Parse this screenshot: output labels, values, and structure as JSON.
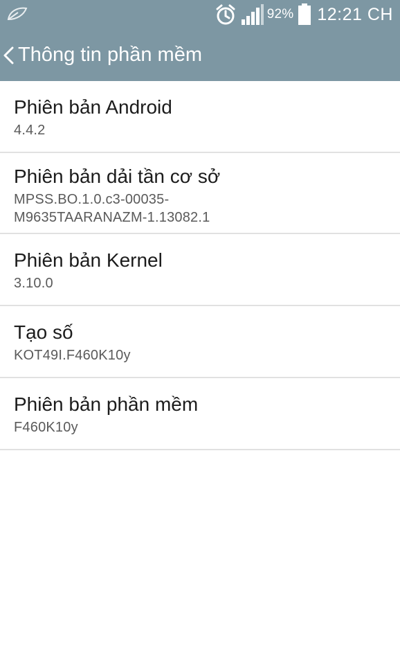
{
  "status_bar": {
    "leaf_icon": "leaf-icon",
    "alarm_icon": "alarm-clock-icon",
    "signal_icon": "signal-bars-icon",
    "battery_percent": "92%",
    "battery_icon": "battery-icon",
    "battery_level": 0.92,
    "time": "12:21 CH"
  },
  "action_bar": {
    "back_icon": "chevron-left-icon",
    "title": "Thông tin phần mềm",
    "background_color": "#7d97a3"
  },
  "items": [
    {
      "title": "Phiên bản Android",
      "value": "4.4.2"
    },
    {
      "title": "Phiên bản dải tần cơ sở",
      "value": "MPSS.BO.1.0.c3-00035-\nM9635TAARANAZM-1.13082.1"
    },
    {
      "title": "Phiên bản Kernel",
      "value": "3.10.0"
    },
    {
      "title": "Tạo số",
      "value": "KOT49I.F460K10y"
    },
    {
      "title": "Phiên bản phần mềm",
      "value": "F460K10y"
    }
  ]
}
